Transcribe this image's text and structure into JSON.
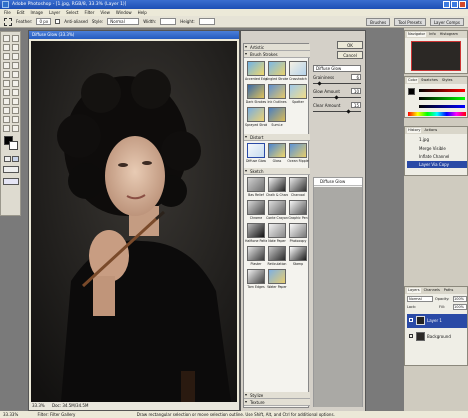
{
  "window": {
    "title": "Adobe Photoshop - [1.jpg, RGB/8, 33.3% (Layer 1)]"
  },
  "menubar": {
    "items": [
      "File",
      "Edit",
      "Image",
      "Layer",
      "Select",
      "Filter",
      "View",
      "Window",
      "Help"
    ]
  },
  "options": {
    "feather_label": "Feather:",
    "feather_value": "0 px",
    "antialias_label": "Anti-aliased",
    "style_label": "Style:",
    "style_value": "Normal",
    "width_label": "Width:",
    "height_label": "Height:",
    "tabs": [
      "Brushes",
      "Tool Presets",
      "Layer Comps"
    ]
  },
  "document": {
    "title": "Diffuse Glow (33.3%)",
    "zoom": "33.3%",
    "status": "Doc: 34.5M/34.5M"
  },
  "gallery": {
    "folders": {
      "artistic": "Artistic",
      "brush": "Brush Strokes",
      "distort": "Distort",
      "sketch": "Sketch",
      "stylize": "Stylize",
      "texture": "Texture"
    },
    "brush_thumbs": [
      "Accented Edges",
      "Angled Strokes",
      "Crosshatch",
      "Dark Strokes",
      "Ink Outlines",
      "Spatter",
      "Sprayed Strokes",
      "Sumi-e"
    ],
    "distort_thumbs": [
      "Diffuse Glow",
      "Glass",
      "Ocean Ripple"
    ],
    "sketch_thumbs": [
      "Bas Relief",
      "Chalk & Charcoal",
      "Charcoal",
      "Chrome",
      "Conte Crayon",
      "Graphic Pen",
      "Halftone Pattern",
      "Note Paper",
      "Photocopy",
      "Plaster",
      "Reticulation",
      "Stamp",
      "Torn Edges",
      "Water Paper"
    ],
    "ok_label": "OK",
    "cancel_label": "Cancel",
    "filter_select": "Diffuse Glow",
    "graininess_label": "Graininess",
    "graininess_value": "6",
    "glow_label": "Glow Amount",
    "glow_value": "10",
    "clear_label": "Clear Amount",
    "clear_value": "15",
    "layer_name": "Diffuse Glow"
  },
  "panels": {
    "nav_tabs": [
      "Navigator",
      "Info",
      "Histogram"
    ],
    "color_tabs": [
      "Color",
      "Swatches",
      "Styles"
    ],
    "history_tabs": [
      "History",
      "Actions"
    ],
    "history_items": [
      "Merge Visible",
      "Inflate Channel",
      "Layer Via Copy"
    ],
    "history_doc": "1.jpg",
    "layers_tabs": [
      "Layers",
      "Channels",
      "Paths"
    ],
    "blend_mode": "Normal",
    "opacity_label": "Opacity:",
    "opacity_value": "100%",
    "lock_label": "Lock:",
    "fill_label": "Fill:",
    "fill_value": "100%",
    "layers": [
      "Layer 1",
      "Background"
    ]
  },
  "statusbar": {
    "zoom": "33.33%",
    "doc": "Filter: Filter Gallery",
    "hint": "Draw rectangular selection or move selection outline. Use Shift, Alt, and Ctrl for additional options."
  },
  "colors": {
    "accent": "#2a4aa6",
    "titlebar": "#245bbf",
    "canvas_bg": "#1c1a19"
  }
}
